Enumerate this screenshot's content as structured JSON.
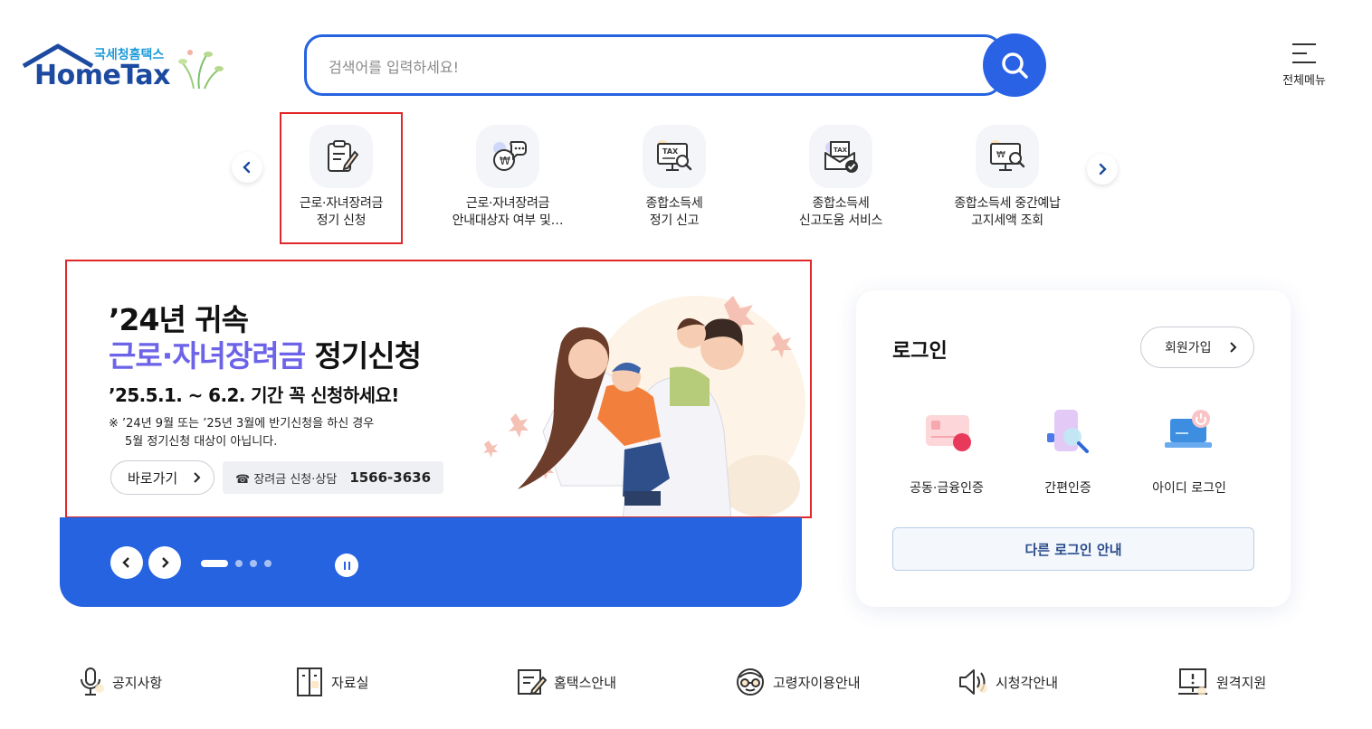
{
  "header": {
    "logo_sub": "국세청홈택스",
    "logo_main": "HomeTax",
    "search_placeholder": "검색어를 입력하세요!",
    "all_menu_label": "전체메뉴"
  },
  "quick_menu": {
    "items": [
      {
        "line1": "근로·자녀장려금",
        "line2": "정기 신청",
        "icon": "clipboard-pen-icon"
      },
      {
        "line1": "근로·자녀장려금",
        "line2": "안내대상자 여부 및…",
        "icon": "won-chat-icon"
      },
      {
        "line1": "종합소득세",
        "line2": "정기 신고",
        "icon": "tax-monitor-icon"
      },
      {
        "line1": "종합소득세",
        "line2": "신고도움 서비스",
        "icon": "tax-envelope-icon"
      },
      {
        "line1": "종합소득세 중간예납",
        "line2": "고지세액 조회",
        "icon": "won-monitor-search-icon"
      }
    ]
  },
  "banner": {
    "line1": "’24년 귀속",
    "line2_highlight": "근로·자녀장려금",
    "line2_rest": " 정기신청",
    "line3": "’25.5.1. ~ 6.2. 기간 꼭 신청하세요!",
    "note_line1": "※  ’24년 9월 또는 ’25년 3월에 반기신청을 하신 경우",
    "note_line2": "5월 정기신청 대상이 아닙니다.",
    "go_label": "바로가기",
    "tel_label": "☎ 장려금 신청·상담",
    "tel_number": "1566-3636",
    "slide_count": 4,
    "active_slide": 1
  },
  "login": {
    "title": "로그인",
    "join_label": "회원가입",
    "options": [
      {
        "label": "공동·금융인증",
        "icon": "certificate-card-icon"
      },
      {
        "label": "간편인증",
        "icon": "phone-search-icon"
      },
      {
        "label": "아이디 로그인",
        "icon": "laptop-power-icon"
      }
    ],
    "other_label": "다른 로그인 안내"
  },
  "footer_links": [
    {
      "label": "공지사항",
      "icon": "microphone-icon"
    },
    {
      "label": "자료실",
      "icon": "cabinet-icon"
    },
    {
      "label": "홈택스안내",
      "icon": "document-pen-icon"
    },
    {
      "label": "고령자이용안내",
      "icon": "glasses-face-icon"
    },
    {
      "label": "시청각안내",
      "icon": "speaker-icon"
    },
    {
      "label": "원격지원",
      "icon": "remote-monitor-icon"
    }
  ],
  "colors": {
    "primary_blue": "#2563e0",
    "logo_blue": "#1c4aa0",
    "banner_highlight": "#6c63e8",
    "highlight_border": "#e12828"
  }
}
